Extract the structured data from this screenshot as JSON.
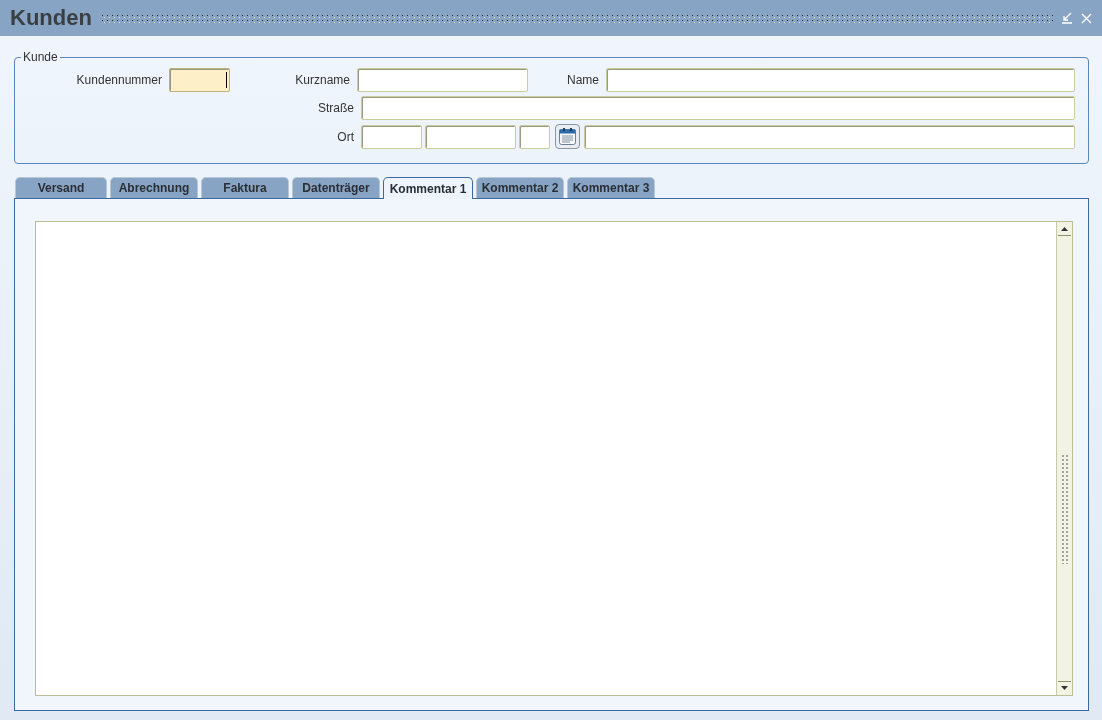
{
  "window": {
    "title": "Kunden"
  },
  "customer_group": {
    "legend": "Kunde",
    "fields": [
      {
        "label": "Kundennummer",
        "focused": true
      },
      {
        "label": "Kurzname",
        "focused": false
      },
      {
        "label": "Name",
        "focused": false
      },
      {
        "label": "Straße",
        "focused": false
      },
      {
        "label": "Ort"
      }
    ],
    "ort_parts": [
      {
        "kind": "input",
        "focused": false
      },
      {
        "kind": "input",
        "focused": false
      },
      {
        "kind": "input",
        "focused": false
      },
      {
        "kind": "calendar-button"
      },
      {
        "kind": "input",
        "focused": false
      }
    ]
  },
  "tabs": [
    {
      "label": "Versand",
      "selected": false
    },
    {
      "label": "Abrechnung",
      "selected": false
    },
    {
      "label": "Faktura",
      "selected": false
    },
    {
      "label": "Datenträger",
      "selected": false
    },
    {
      "label": "Kommentar 1",
      "selected": true
    },
    {
      "label": "Kommentar 2",
      "selected": false
    },
    {
      "label": "Kommentar 3",
      "selected": false
    }
  ]
}
